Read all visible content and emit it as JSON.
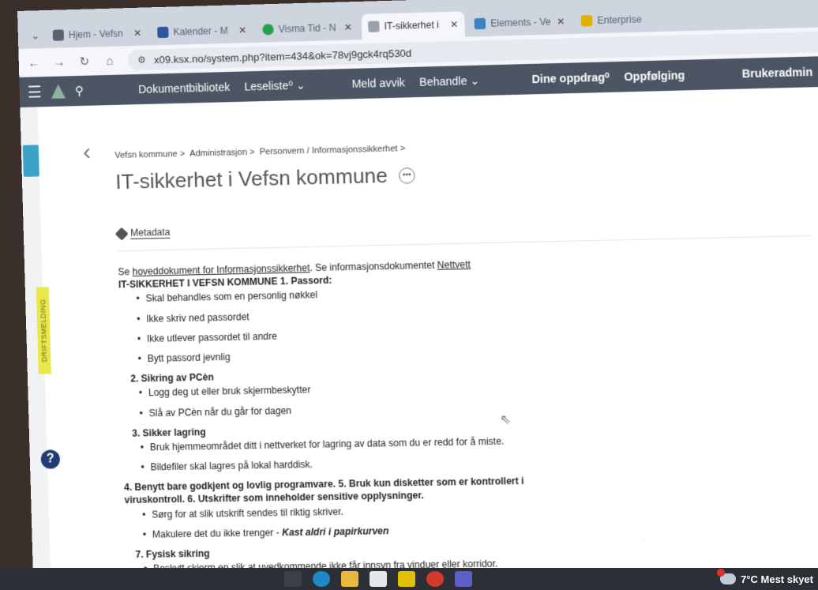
{
  "browser": {
    "tabs": [
      {
        "title": "Hjem - Vefsn",
        "color": "#5a6270",
        "active": false
      },
      {
        "title": "Kalender - M",
        "color": "#2b579a",
        "active": false
      },
      {
        "title": "Visma Tid - N",
        "color": "#24a148",
        "active": false
      },
      {
        "title": "IT-sikkerhet i",
        "color": "#9aa3ad",
        "active": true
      },
      {
        "title": "Elements - Ve",
        "color": "#3b82c4",
        "active": false
      },
      {
        "title": "Enterprise",
        "color": "#e2b100",
        "active": false
      }
    ],
    "url": "x09.ksx.no/system.php?item=434&ok=78vj9gck4rq530d"
  },
  "appnav": {
    "items": [
      "Dokumentbibliotek",
      "Leseliste⁰ ⌄",
      "Meld avvik",
      "Behandle ⌄"
    ],
    "right_items": [
      "Dine oppdrag⁰",
      "Oppfølging",
      "Brukeradmin"
    ]
  },
  "breadcrumb": [
    "Vefsn kommune >",
    "Administrasjon >",
    "Personvern / Informasjonssikkerhet >"
  ],
  "page_title": "IT-sikkerhet i Vefsn kommune",
  "metadata_label": "Metadata",
  "drift_label": "DRIFTSMELDING",
  "body": {
    "lead_prefix": "Se ",
    "lead_link1": "hoveddokument for Informasjonssikkerhet",
    "lead_middle": ". Se informasjonsdokumentet ",
    "lead_link2": "Nettvett",
    "s1_heading": "IT-SIKKERHET I VEFSN KOMMUNE  1.   Passord:",
    "s1_items": [
      "Skal behandles som en personlig nøkkel",
      "Ikke skriv ned passordet",
      "Ikke utlever passordet til andre",
      "Bytt passord jevnlig"
    ],
    "s2_heading": "2.   Sikring av PCèn",
    "s2_items": [
      "Logg deg ut eller bruk skjermbeskytter",
      "Slå av PCèn når du går for dagen"
    ],
    "s3_heading": "3.   Sikker lagring",
    "s3_items": [
      "Bruk hjemmeområdet ditt i nettverket for lagring av data som du er redd for å miste.",
      "Bildefiler skal lagres på lokal harddisk."
    ],
    "s4_heading": "4.   Benytt bare godkjent og lovlig programvare.   5.    Bruk kun disketter som er kontrollert i viruskontroll.   6.    Utskrifter som inneholder sensitive opplysninger.",
    "s4_item1": "Sørg for at slik utskrift sendes til riktig skriver.",
    "s4_item2_prefix": "Makulere det du ikke trenger - ",
    "s4_item2_italic": "Kast aldri i papirkurven",
    "s7_heading": "7.   Fysisk sikring",
    "s7_items": [
      "Beskytt skjerm en slik at uvedkommende ikke får innsyn fra vinduer eller korridor."
    ]
  },
  "taskbar": {
    "weather": "7°C  Mest skyet"
  }
}
